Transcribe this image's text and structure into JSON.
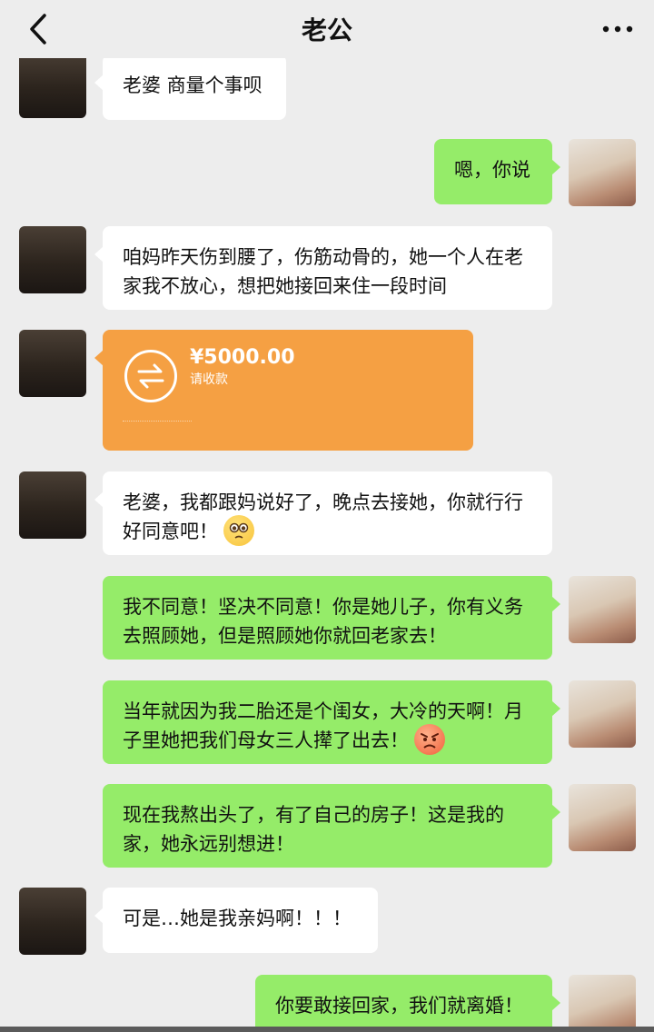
{
  "header": {
    "title": "老公",
    "back_icon": "chevron-left-icon",
    "more_icon": "more-horizontal-icon"
  },
  "colors": {
    "background": "#ededed",
    "incoming_bubble": "#ffffff",
    "outgoing_bubble": "#95ec69",
    "transfer_card": "#f5a043"
  },
  "messages": [
    {
      "sender": "husband",
      "text": "老婆 商量个事呗"
    },
    {
      "sender": "me",
      "text": "嗯，你说"
    },
    {
      "sender": "husband",
      "text": "咱妈昨天伤到腰了，伤筋动骨的，她一个人在老家我不放心，想把她接回来住一段时间"
    },
    {
      "sender": "husband",
      "type": "transfer",
      "amount": "¥5000.00",
      "label": "请收款"
    },
    {
      "sender": "husband",
      "text": "老婆，我都跟妈说好了，晚点去接她，你就行行好同意吧！",
      "emoji": "pleading-face-icon"
    },
    {
      "sender": "me",
      "text": "我不同意！坚决不同意！你是她儿子，你有义务去照顾她，但是照顾她你就回老家去！"
    },
    {
      "sender": "me",
      "text": "当年就因为我二胎还是个闺女，大冷的天啊！月子里她把我们母女三人撵了出去！",
      "emoji": "angry-face-icon"
    },
    {
      "sender": "me",
      "text": "现在我熬出头了，有了自己的房子！这是我的家，她永远别想进！"
    },
    {
      "sender": "husband",
      "text": "可是…她是我亲妈啊！！！"
    },
    {
      "sender": "me",
      "text": "你要敢接回家，我们就离婚！"
    }
  ]
}
